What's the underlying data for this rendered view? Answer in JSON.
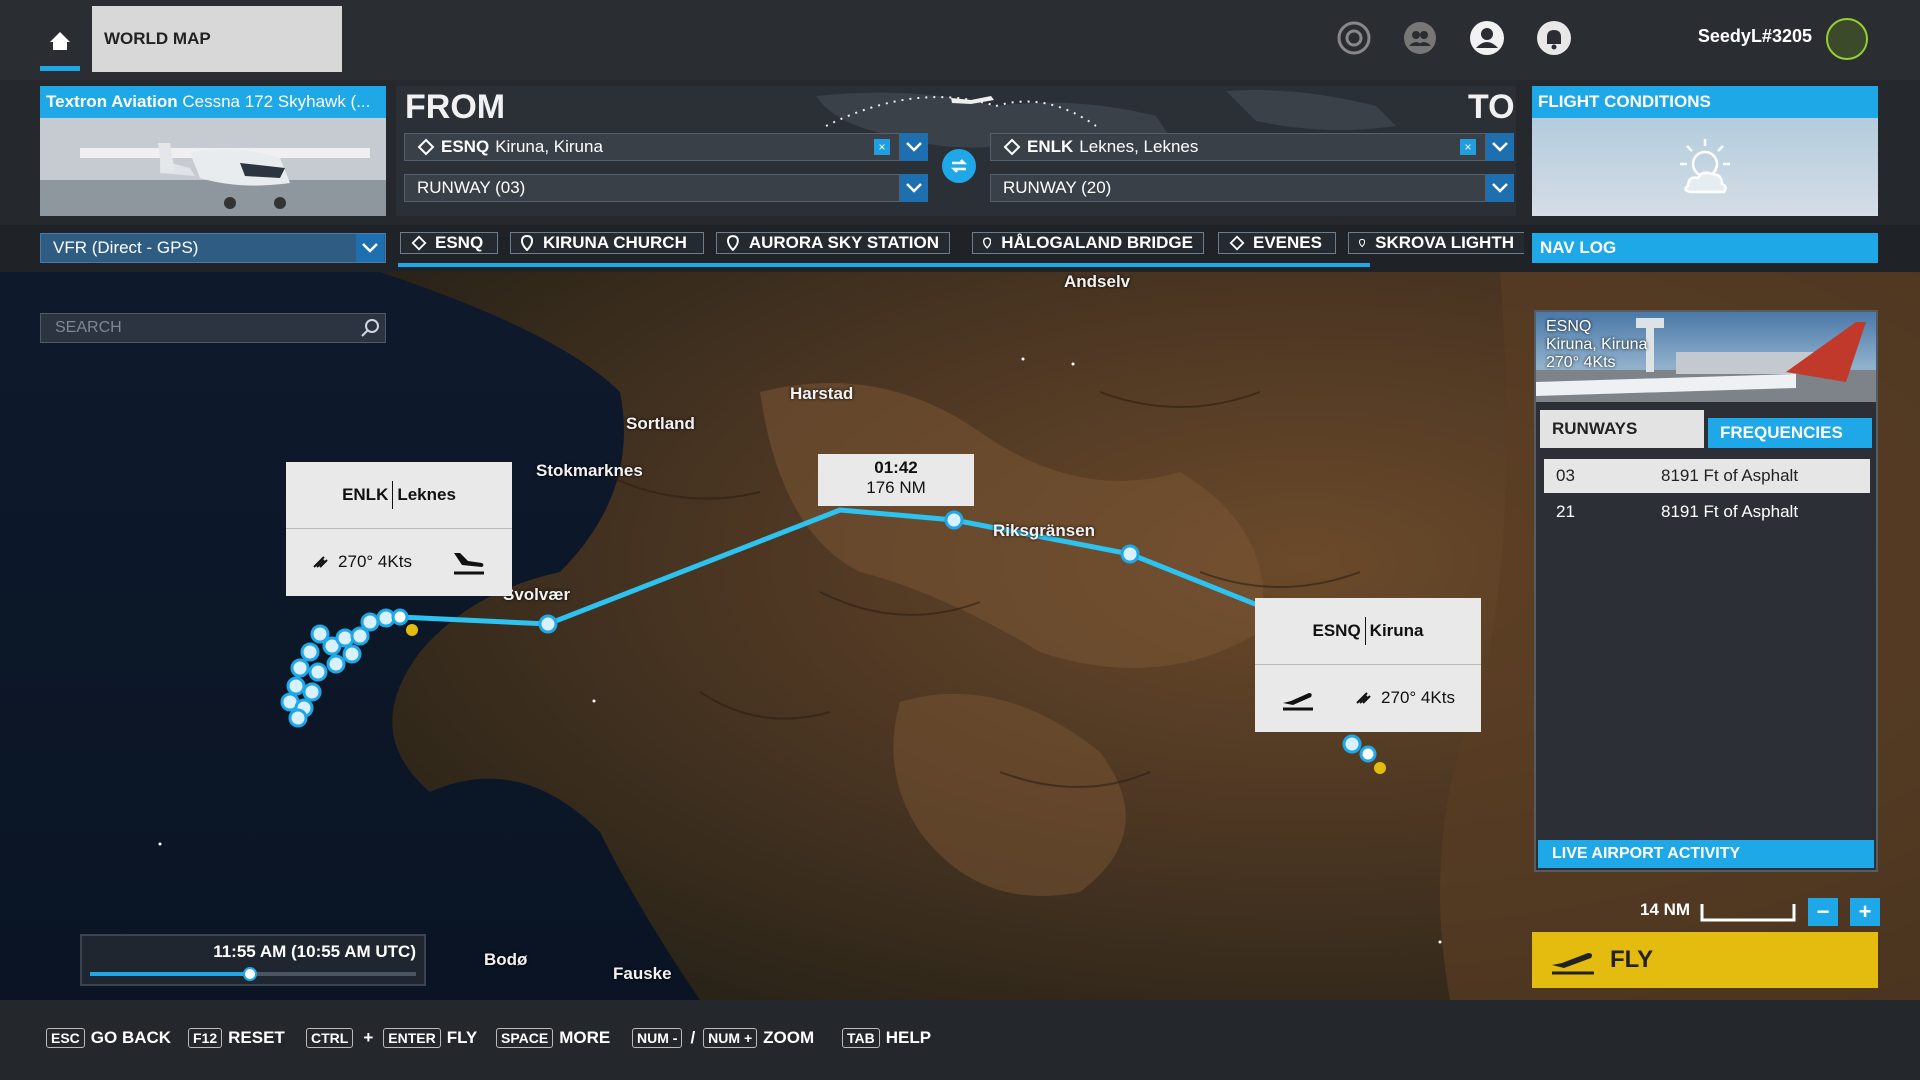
{
  "topbar": {
    "world_map_tab": "WORLD MAP",
    "username": "SeedyL#3205",
    "icons": [
      "home-icon",
      "marketplace-icon",
      "friends-icon",
      "profile-icon",
      "notifications-icon"
    ]
  },
  "aircraft": {
    "brand": "Textron Aviation",
    "model": "Cessna 172 Skyhawk (..."
  },
  "route": {
    "from_label": "FROM",
    "to_label": "TO",
    "departure": {
      "icao": "ESNQ",
      "name": "Kiruna, Kiruna",
      "runway": "RUNWAY (03)"
    },
    "arrival": {
      "icao": "ENLK",
      "name": "Leknes, Leknes",
      "runway": "RUNWAY (20)"
    },
    "clear_glyph": "×"
  },
  "flight_conditions": {
    "title": "FLIGHT CONDITIONS"
  },
  "flight_plan": {
    "type": "VFR (Direct - GPS)"
  },
  "waypoints": [
    "ESNQ",
    "KIRUNA CHURCH",
    "AURORA SKY STATION",
    "HÅLOGALAND BRIDGE",
    "EVENES",
    "SKROVA LIGHTH"
  ],
  "nav_log": "NAV LOG",
  "search": {
    "placeholder": "SEARCH"
  },
  "map": {
    "places": [
      "Andselv",
      "Harstad",
      "Sortland",
      "Stokmarknes",
      "Svolvær",
      "Riksgränsen",
      "Bodø",
      "Fauske"
    ],
    "leg": {
      "time": "01:42",
      "distance": "176 NM"
    },
    "arrival_callout": {
      "icao": "ENLK",
      "name": "Leknes",
      "wind": "270° 4Kts"
    },
    "departure_callout": {
      "icao": "ESNQ",
      "name": "Kiruna",
      "wind": "270° 4Kts"
    }
  },
  "airport_panel": {
    "icao": "ESNQ",
    "name": "Kiruna, Kiruna",
    "wind": "270° 4Kts",
    "tabs": {
      "runways": "RUNWAYS",
      "frequencies": "FREQUENCIES"
    },
    "runways": [
      {
        "id": "03",
        "desc": "8191 Ft of Asphalt"
      },
      {
        "id": "21",
        "desc": "8191 Ft of Asphalt"
      }
    ],
    "live_activity": "LIVE AIRPORT ACTIVITY"
  },
  "zoom": {
    "scale": "14 NM",
    "minus": "−",
    "plus": "+"
  },
  "fly_label": "FLY",
  "time": {
    "label": "11:55 AM (10:55 AM UTC)",
    "slider_fraction": 0.49
  },
  "hints": {
    "esc": "ESC",
    "go_back": "GO BACK",
    "f12": "F12",
    "reset": "RESET",
    "ctrl": "CTRL",
    "plus": "+",
    "enter": "ENTER",
    "fly": "FLY",
    "space": "SPACE",
    "more": "MORE",
    "num_minus": "NUM -",
    "slash": "/",
    "num_plus": "NUM +",
    "zoom": "ZOOM",
    "tab": "TAB",
    "help": "HELP"
  }
}
